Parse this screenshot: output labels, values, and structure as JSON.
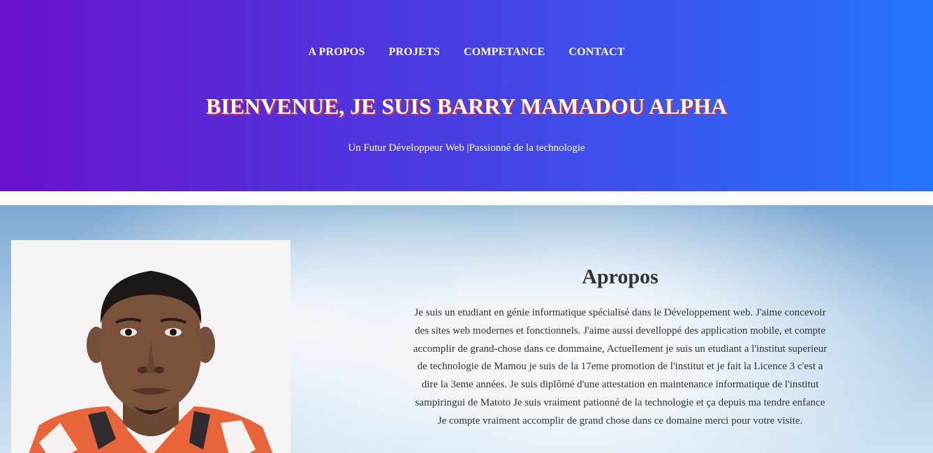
{
  "nav": {
    "items": [
      {
        "label": "A PROPOS"
      },
      {
        "label": "PROJETS"
      },
      {
        "label": "COMPETANCE"
      },
      {
        "label": "CONTACT"
      }
    ]
  },
  "hero": {
    "title": "BIENVENUE, JE SUIS BARRY MAMADOU ALPHA",
    "subtitle": "Un Futur Développeur Web |Passionné de la technologie"
  },
  "about": {
    "heading": "Apropos",
    "paragraph": "Je suis un etudiant en génie informatique spécialisé dans le Développement web. J'aime concevoir des sites web modernes et fonctionnels. J'aime aussi develloppé des application mobile, et compte accomplir de grand-chose dans ce dommaine, Actuellement je suis un etudiant a l'institut superieur de technologie de Mamou je suis de la 17eme promotion de l'institut et je fait la Licence 3 c'est a dire la 3eme années. Je suis diplômé d'une attestation en maintenance informatique de l'institut sampiringui de Matoto Je suis vraiment pationné de la technologie et ça depuis ma tendre enfance Je compte vraiment accomplir de grand chose dans ce domaine merci pour votre visite."
  },
  "colors": {
    "hero_gradient_start": "#6a11cb",
    "hero_gradient_end": "#2575fc",
    "title_shadow": "#e0303a",
    "text_dark": "#333333"
  }
}
